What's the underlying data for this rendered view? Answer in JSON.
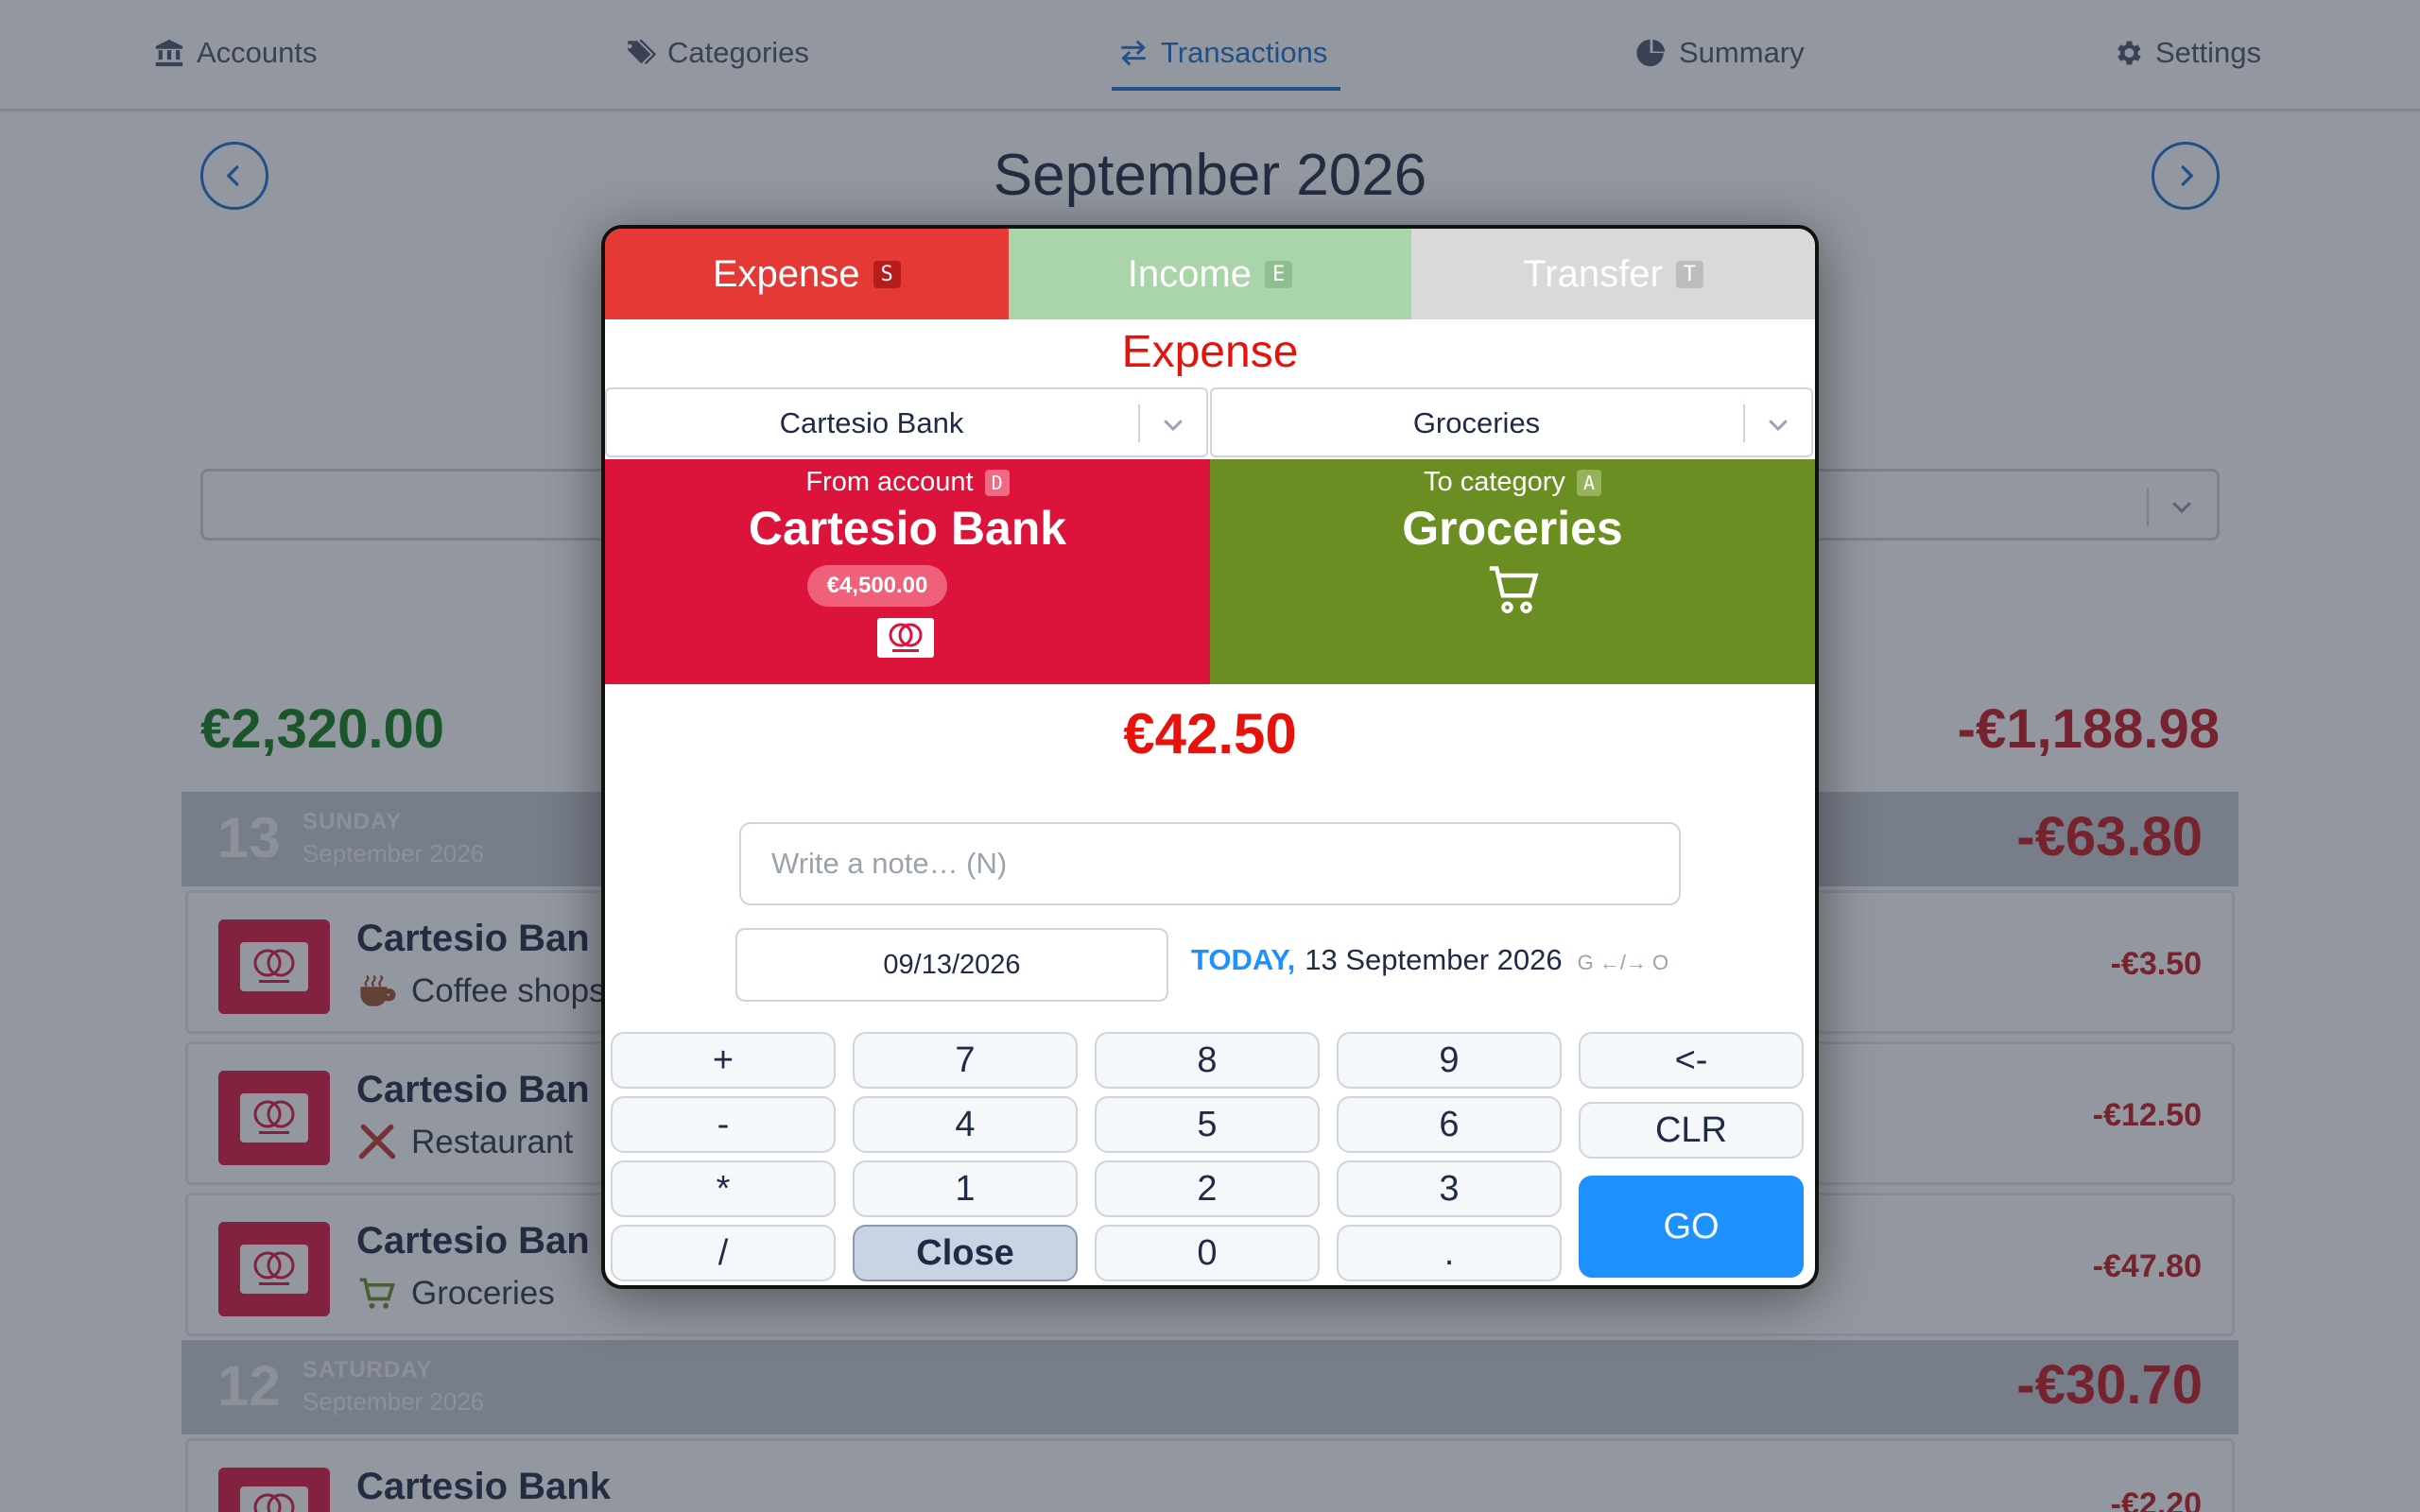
{
  "nav": {
    "accounts": "Accounts",
    "categories": "Categories",
    "transactions": "Transactions",
    "summary": "Summary",
    "settings": "Settings",
    "active": "Transactions"
  },
  "month": {
    "title": "September 2026"
  },
  "totals": {
    "income": "€2,320.00",
    "expense": "-€1,188.98"
  },
  "days": [
    {
      "num": "13",
      "name": "SUNDAY",
      "month": "September 2026",
      "total": "-€63.80"
    },
    {
      "num": "12",
      "name": "SATURDAY",
      "month": "September 2026",
      "total": "-€30.70"
    }
  ],
  "transactions": [
    {
      "account": "Cartesio Ban",
      "category": "Coffee shops",
      "amount": "-€3.50",
      "icon": "coffee-icon"
    },
    {
      "account": "Cartesio Ban",
      "category": "Restaurant",
      "amount": "-€12.50",
      "icon": "utensils-icon"
    },
    {
      "account": "Cartesio Ban",
      "category": "Groceries",
      "amount": "-€47.80",
      "icon": "cart-icon"
    },
    {
      "account": "Cartesio Bank",
      "category": "",
      "amount": "-€2.20",
      "icon": "cart-icon"
    }
  ],
  "modal": {
    "tabs": [
      {
        "label": "Expense",
        "key": "S"
      },
      {
        "label": "Income",
        "key": "E"
      },
      {
        "label": "Transfer",
        "key": "T"
      }
    ],
    "mode_title": "Expense",
    "from_select": "Cartesio Bank",
    "to_select": "Groceries",
    "from": {
      "label": "From account",
      "key": "D",
      "name": "Cartesio Bank",
      "balance": "€4,500.00"
    },
    "to": {
      "label": "To category",
      "key": "A",
      "name": "Groceries"
    },
    "amount": "€42.50",
    "note_placeholder": "Write a note…  (N)",
    "date_value": "09/13/2026",
    "date_today": "TODAY,",
    "date_long": "13 September 2026",
    "date_hint": "G ←/→ O",
    "keys": {
      "plus": "+",
      "minus": "-",
      "times": "*",
      "divide": "/",
      "k7": "7",
      "k8": "8",
      "k9": "9",
      "k4": "4",
      "k5": "5",
      "k6": "6",
      "k1": "1",
      "k2": "2",
      "k3": "3",
      "close": "Close",
      "k0": "0",
      "dot": ".",
      "back": "<-",
      "clr": "CLR",
      "go": "GO"
    }
  },
  "colors": {
    "accent": "#1a6fcf",
    "expense": "#e53935",
    "income": "#aad5aa",
    "transfer": "#d9d9d9",
    "account": "#dc143c",
    "category": "#6b8e23",
    "go": "#1e90ff"
  }
}
